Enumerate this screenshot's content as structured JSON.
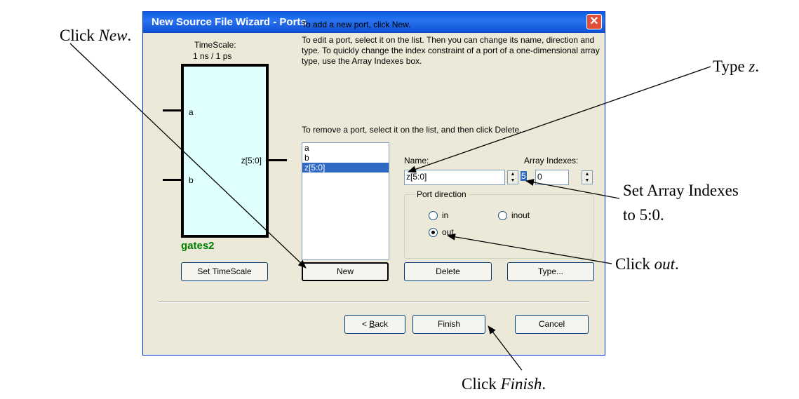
{
  "annotations": {
    "click_new_prefix": "Click ",
    "click_new_em": "New",
    "click_new_suffix": ".",
    "type_z_prefix": "Type ",
    "type_z_em": "z",
    "type_z_suffix": ".",
    "set_array_line1": "Set Array  Indexes",
    "set_array_line2": "to 5:0.",
    "click_out_prefix": "Click ",
    "click_out_em": "out",
    "click_out_suffix": ".",
    "click_finish_prefix": "Click ",
    "click_finish_em": "Finish",
    "click_finish_suffix": "."
  },
  "dialog": {
    "title": "New Source File Wizard - Ports",
    "close_glyph": "✕",
    "timescale_label": "TimeScale:",
    "timescale_value": "1 ns / 1 ps",
    "block": {
      "port_a": "a",
      "port_b": "b",
      "port_z": "z[5:0]",
      "entity_name": "gates2"
    },
    "instructions": {
      "line1": "To add a new port, click New.",
      "para2": "To edit a port, select it on the list. Then you can change its name, direction and type. To quickly change the index constraint of a port of a one-dimensional array type, use the Array Indexes box.",
      "para3": "To remove a port, select it on the list, and then click Delete."
    },
    "ports_list": [
      "a",
      "b",
      "z[5:0]"
    ],
    "selected_port_index": 2,
    "name_label": "Name:",
    "name_value": "z[5:0]",
    "array_indexes_label": "Array Indexes:",
    "array_index_high": "5",
    "array_index_low": "0",
    "port_direction": {
      "legend": "Port direction",
      "in_label": "in",
      "inout_label": "inout",
      "out_label": "out",
      "selected": "out"
    },
    "buttons": {
      "set_timescale": "Set TimeScale",
      "new": "New",
      "delete": "Delete",
      "type": "Type...",
      "back_prefix": "< ",
      "back_accel": "B",
      "back_rest": "ack",
      "finish": "Finish",
      "cancel": "Cancel"
    }
  }
}
